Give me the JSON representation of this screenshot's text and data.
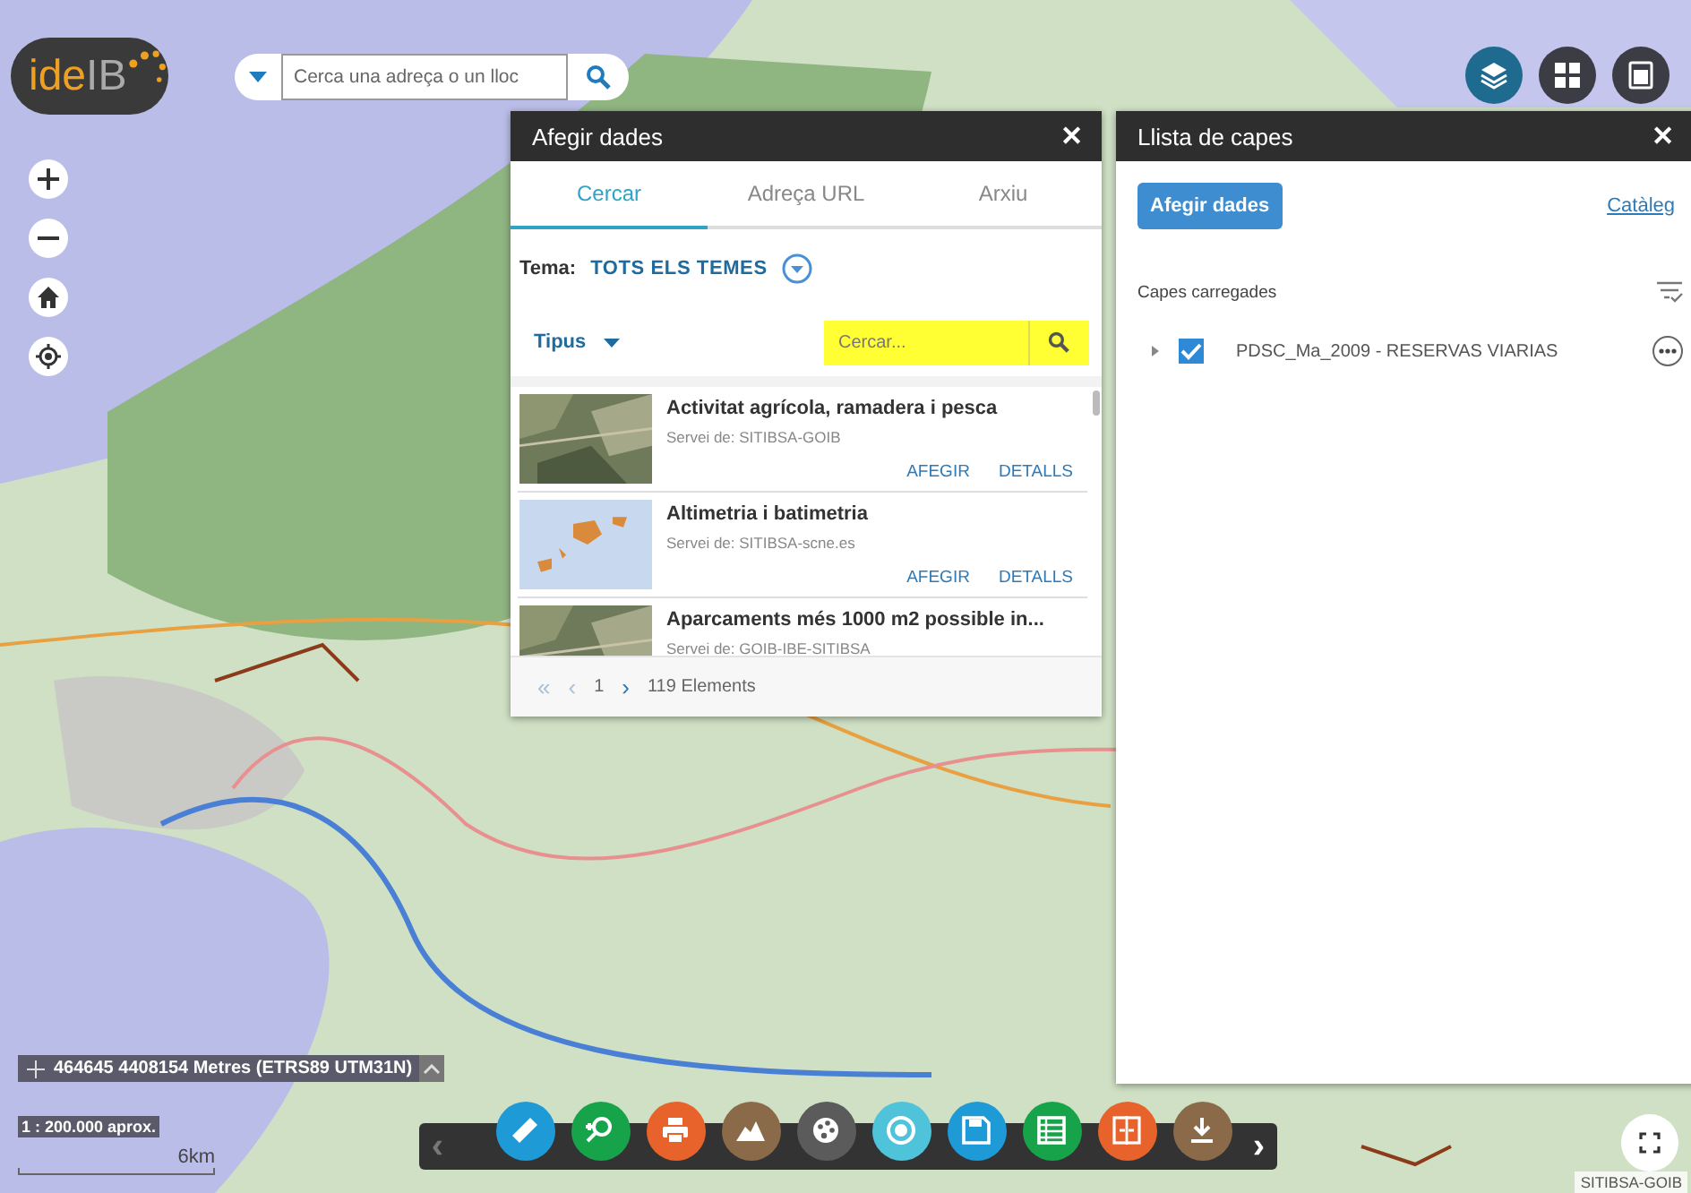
{
  "logo": {
    "prefix": "ide",
    "suffix": "IB"
  },
  "search": {
    "placeholder": "Cerca una adreça o un lloc"
  },
  "top_buttons": [
    {
      "kind": "layers",
      "selected": true
    },
    {
      "kind": "grid",
      "selected": false
    },
    {
      "kind": "panel",
      "selected": false
    }
  ],
  "map_controls": [
    {
      "kind": "zoom_in"
    },
    {
      "kind": "zoom_out"
    },
    {
      "kind": "home"
    },
    {
      "kind": "locate"
    }
  ],
  "add_data_dialog": {
    "title": "Afegir dades",
    "close": "✕",
    "tabs": [
      {
        "label": "Cercar",
        "selected": true
      },
      {
        "label": "Adreça URL",
        "selected": false
      },
      {
        "label": "Arxiu",
        "selected": false
      }
    ],
    "theme_label": "Tema:",
    "theme_value": "TOTS ELS TEMES",
    "type_filter": "Tipus",
    "search_placeholder": "Cercar...",
    "results": [
      {
        "title": "Activitat agrícola, ramadera i pesca",
        "service": "Servei de: SITIBSA-GOIB",
        "actions": [
          "AFEGIR",
          "DETALLS"
        ]
      },
      {
        "title": "Altimetria i batimetria",
        "service": "Servei de: SITIBSA-scne.es",
        "actions": [
          "AFEGIR",
          "DETALLS"
        ]
      },
      {
        "title": "Aparcaments més 1000 m2 possible in...",
        "service": "Servei de: GOIB-IBE-SITIBSA"
      }
    ],
    "pager": {
      "first": "«",
      "prev": "‹",
      "page": "1",
      "next": "›",
      "count": "119 Elements"
    }
  },
  "layer_panel": {
    "title": "Llista de capes",
    "close": "✕",
    "add_button": "Afegir dades",
    "catalog_link": "Catàleg",
    "section": "Capes carregades",
    "layers": [
      {
        "name": "PDSC_Ma_2009 - RESERVAS VIARIAS",
        "checked": true,
        "expanded": false
      }
    ]
  },
  "coordinates": "464645 4408154 Metres (ETRS89 UTM31N)",
  "scale": "1 : 200.000 aprox.",
  "scale_bar": "6km",
  "toolbar": {
    "prev": "‹",
    "next": "›",
    "tools": [
      {
        "kind": "ruler",
        "color": "#1e9ad6"
      },
      {
        "kind": "zoom",
        "color": "#16a34a"
      },
      {
        "kind": "print",
        "color": "#e8632b"
      },
      {
        "kind": "profile",
        "color": "#8b6a4a"
      },
      {
        "kind": "palette",
        "color": "#5b5b5b"
      },
      {
        "kind": "target",
        "color": "#4fc3d9"
      },
      {
        "kind": "save",
        "color": "#1e9ad6"
      },
      {
        "kind": "table",
        "color": "#16a34a"
      },
      {
        "kind": "compare",
        "color": "#e8632b"
      },
      {
        "kind": "download",
        "color": "#8b6a4a"
      }
    ]
  },
  "attribution": "SITIBSA-GOIB"
}
